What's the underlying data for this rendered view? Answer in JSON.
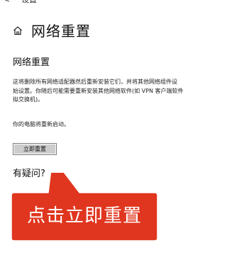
{
  "topbar": {
    "back_glyph": "<",
    "title_partial": "设置"
  },
  "header": {
    "icon": "home-icon",
    "title": "网络重置"
  },
  "section": {
    "heading": "网络重置",
    "description_lines": [
      "这将删除所有网络适配器然后重新安装它们，并将其他网络组件设",
      "始设置。你随后可能需要重新安装其他网络软件(如 VPN 客户端软件",
      "拟交换机)。"
    ],
    "restart_note": "你的电脑将重新启动。",
    "reset_button_label": "立即重置",
    "questions_heading": "有疑问?"
  },
  "callout": {
    "text": "点击立即重置",
    "color": "#e0361f"
  }
}
